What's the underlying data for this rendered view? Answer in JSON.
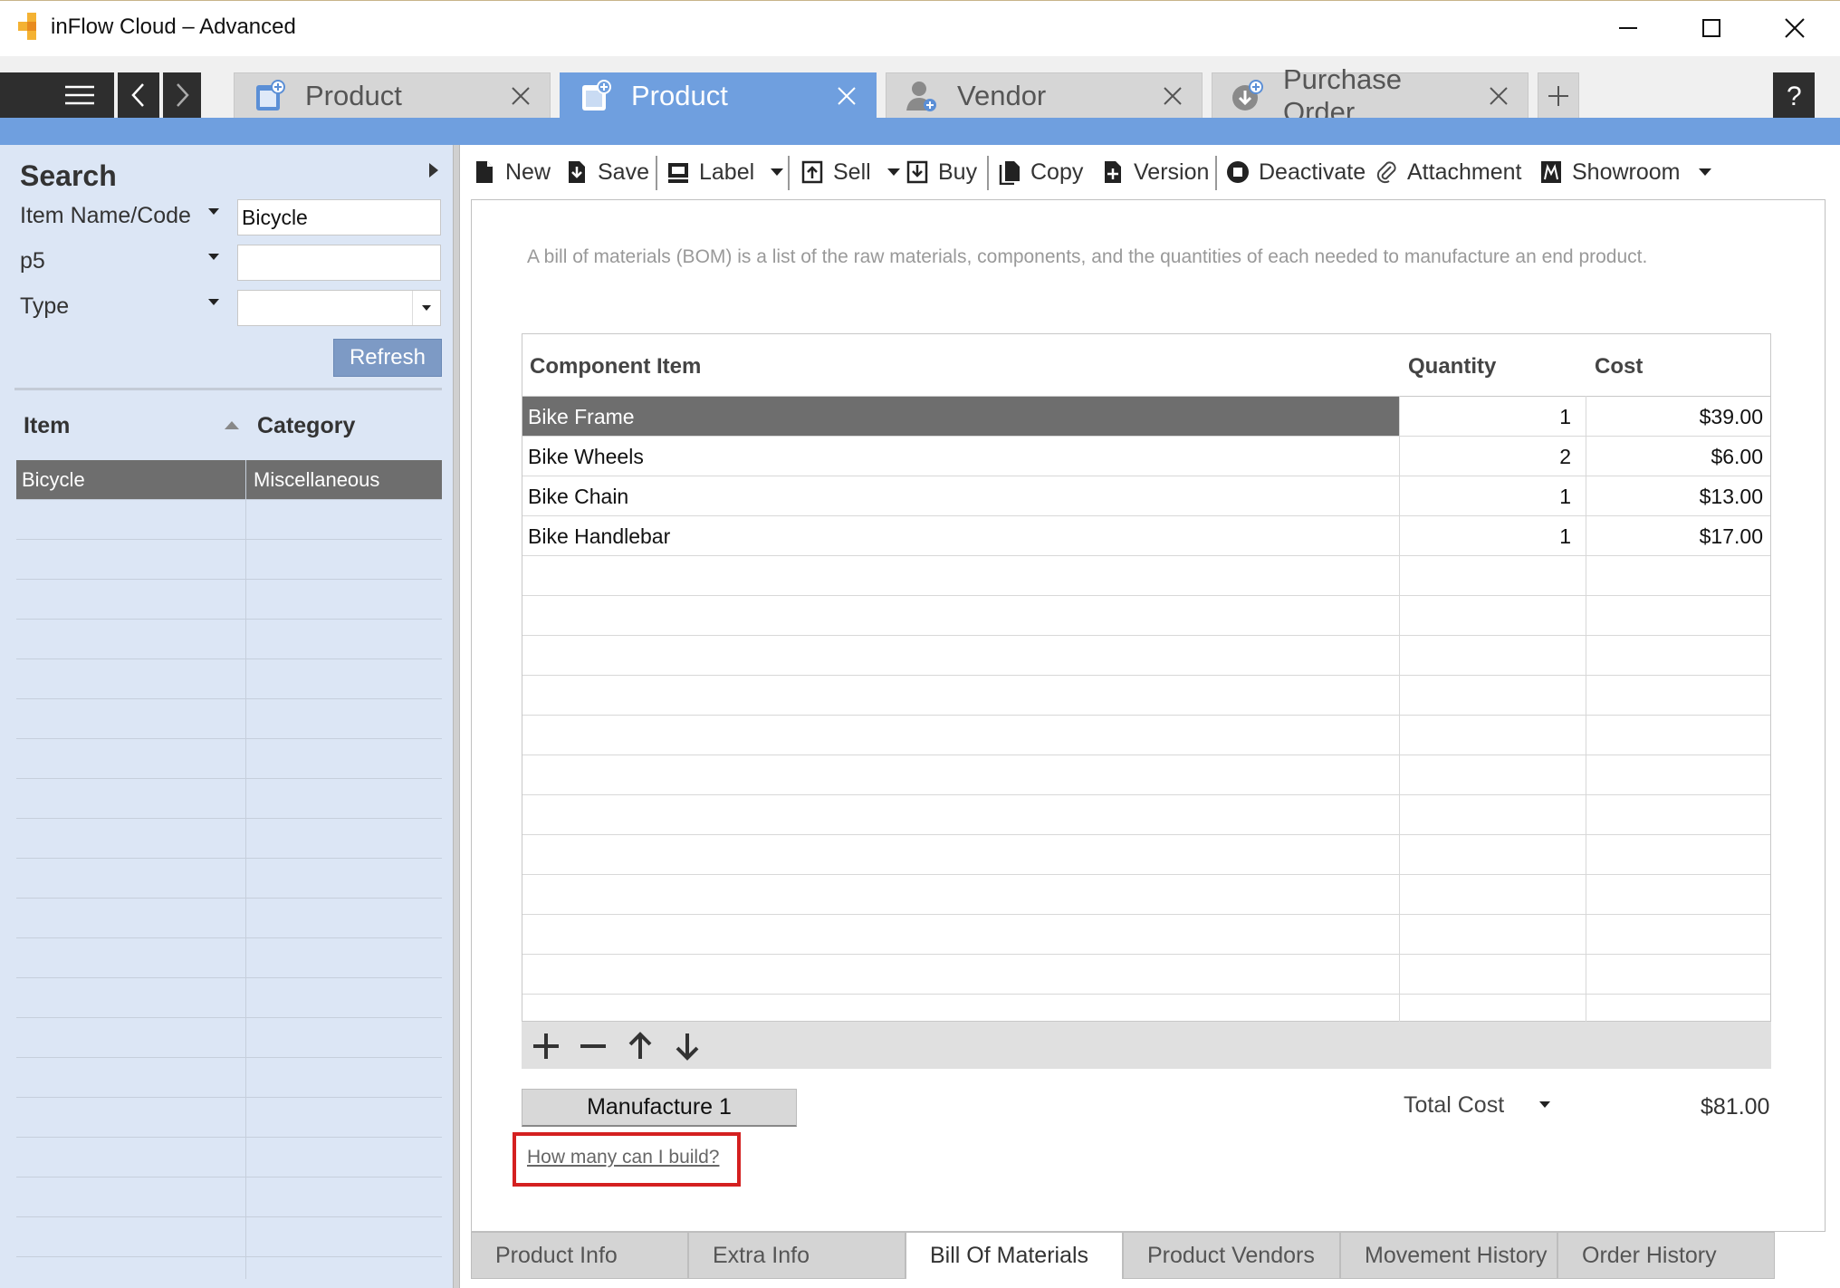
{
  "window": {
    "title": "inFlow Cloud – Advanced"
  },
  "tabs": [
    {
      "label": "Product",
      "icon": "product-icon",
      "active": false
    },
    {
      "label": "Product",
      "icon": "product-icon",
      "active": true
    },
    {
      "label": "Vendor",
      "icon": "vendor-icon",
      "active": false
    },
    {
      "label": "Purchase Order",
      "icon": "purchase-order-icon",
      "active": false
    }
  ],
  "search": {
    "title": "Search",
    "fields": [
      {
        "label": "Item Name/Code",
        "value": "Bicycle"
      },
      {
        "label": "p5",
        "value": ""
      },
      {
        "label": "Type",
        "value": ""
      }
    ],
    "refresh_label": "Refresh",
    "list": {
      "columns": [
        "Item",
        "Category"
      ],
      "rows": [
        {
          "item": "Bicycle",
          "category": "Miscellaneous"
        }
      ]
    }
  },
  "toolbar": {
    "new": "New",
    "save": "Save",
    "label": "Label",
    "sell": "Sell",
    "buy": "Buy",
    "copy": "Copy",
    "version": "Version",
    "deactivate": "Deactivate",
    "attachment": "Attachment",
    "showroom": "Showroom"
  },
  "bom": {
    "description": "A bill of materials (BOM) is a list of the raw materials, components, and the quantities of each needed to manufacture an end product.",
    "columns": [
      "Component Item",
      "Quantity",
      "Cost"
    ],
    "rows": [
      {
        "item": "Bike Frame",
        "quantity": "1",
        "cost": "$39.00"
      },
      {
        "item": "Bike Wheels",
        "quantity": "2",
        "cost": "$6.00"
      },
      {
        "item": "Bike Chain",
        "quantity": "1",
        "cost": "$13.00"
      },
      {
        "item": "Bike Handlebar",
        "quantity": "1",
        "cost": "$17.00"
      }
    ],
    "manufacture_label": "Manufacture 1",
    "total_label": "Total Cost",
    "total_value": "$81.00",
    "build_link": "How many can I build?"
  },
  "bottom_tabs": [
    "Product Info",
    "Extra Info",
    "Bill Of Materials",
    "Product Vendors",
    "Movement History",
    "Order History"
  ],
  "colors": {
    "accent": "#6f9fdf",
    "panel": "#dce6f5",
    "selected_row": "#6e6e6e",
    "highlight": "#d42020"
  }
}
